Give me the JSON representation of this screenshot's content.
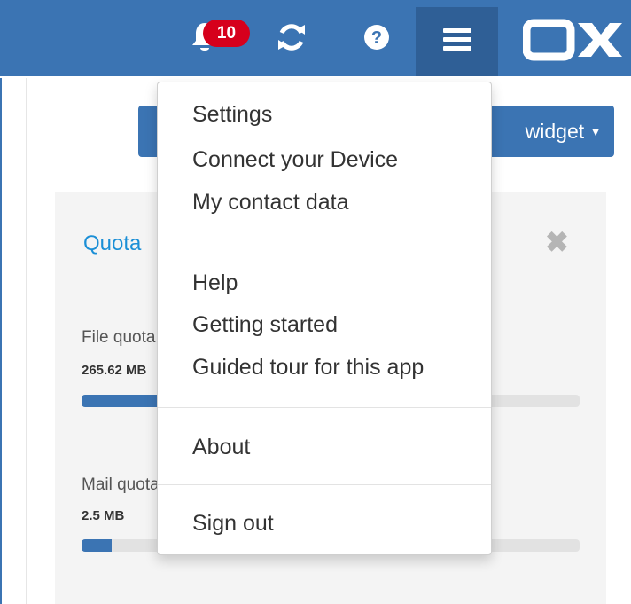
{
  "topbar": {
    "notification_count": "10",
    "icons": {
      "notifications": "bell-icon",
      "refresh": "refresh-icon",
      "help": "question-circle-icon",
      "menu": "hamburger-menu-icon"
    },
    "logo": "OX",
    "colors": {
      "bar": "#3b74b3",
      "active": "#2f5f96",
      "badge": "#d6001c"
    }
  },
  "toolbar": {
    "add_widget_label": "widget"
  },
  "widget": {
    "title": "Quota",
    "file_quota_label": "File quota",
    "file_quota_value": "265.62 MB",
    "file_quota_fraction": 0.66,
    "mail_quota_label": "Mail quota",
    "mail_quota_value": "2.5 MB",
    "mail_quota_fraction": 0.06
  },
  "menu": {
    "settings": "Settings",
    "connect_device": "Connect your Device",
    "contact_data": "My contact data",
    "help": "Help",
    "getting_started": "Getting started",
    "guided_tour": "Guided tour for this app",
    "about": "About",
    "sign_out": "Sign out"
  }
}
